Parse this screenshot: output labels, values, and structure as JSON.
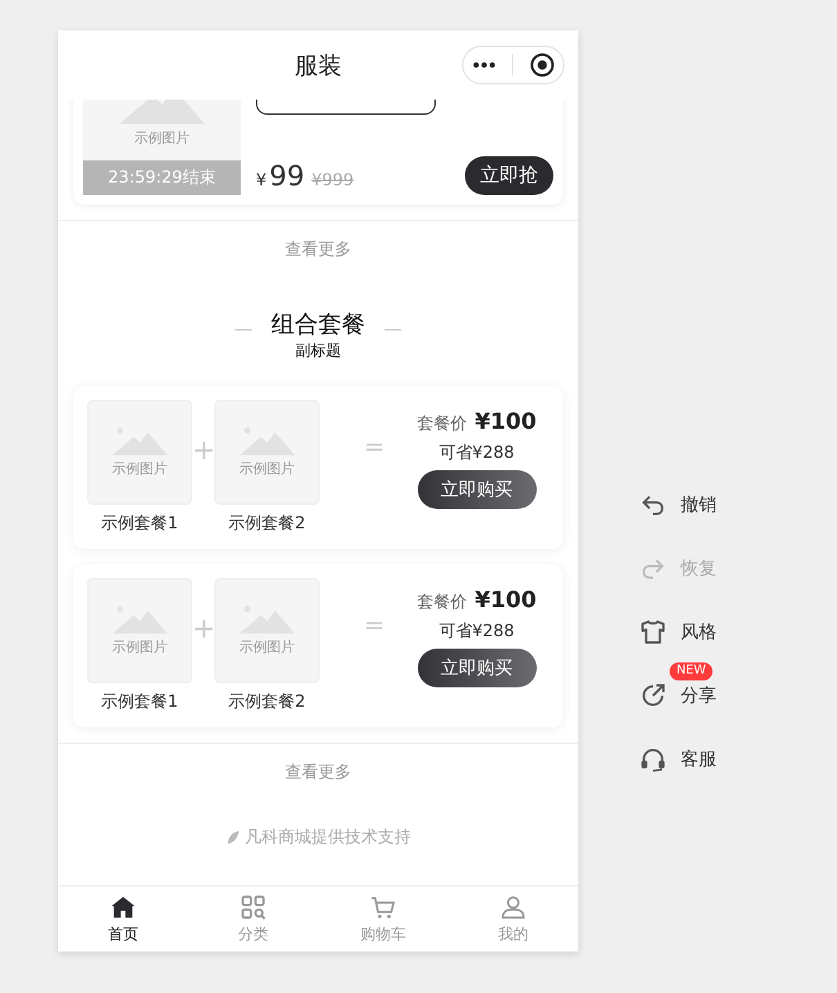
{
  "header": {
    "title": "服装"
  },
  "flash_sale": {
    "image_caption": "示例图片",
    "countdown": "23:59:29结束",
    "price_symbol": "¥",
    "price": "99",
    "original_price": "¥999",
    "button": "立即抢",
    "more": "查看更多"
  },
  "bundles": {
    "title": "组合套餐",
    "subtitle": "副标题",
    "more": "查看更多",
    "items": [
      {
        "products": [
          {
            "image_caption": "示例图片",
            "name": "示例套餐1"
          },
          {
            "image_caption": "示例图片",
            "name": "示例套餐2"
          }
        ],
        "plus": "+",
        "equals": "=",
        "price_label": "套餐价",
        "price": "¥100",
        "savings": "可省¥288",
        "button": "立即购买"
      },
      {
        "products": [
          {
            "image_caption": "示例图片",
            "name": "示例套餐1"
          },
          {
            "image_caption": "示例图片",
            "name": "示例套餐2"
          }
        ],
        "plus": "+",
        "equals": "=",
        "price_label": "套餐价",
        "price": "¥100",
        "savings": "可省¥288",
        "button": "立即购买"
      }
    ]
  },
  "footer": {
    "text": "凡科商城提供技术支持"
  },
  "tabs": [
    {
      "label": "首页",
      "selected": true
    },
    {
      "label": "分类",
      "selected": false
    },
    {
      "label": "购物车",
      "selected": false
    },
    {
      "label": "我的",
      "selected": false
    }
  ],
  "side_menu": [
    {
      "label": "撤销",
      "disabled": false
    },
    {
      "label": "恢复",
      "disabled": true
    },
    {
      "label": "风格",
      "disabled": false
    },
    {
      "label": "分享",
      "disabled": false,
      "badge": "NEW"
    },
    {
      "label": "客服",
      "disabled": false
    }
  ]
}
